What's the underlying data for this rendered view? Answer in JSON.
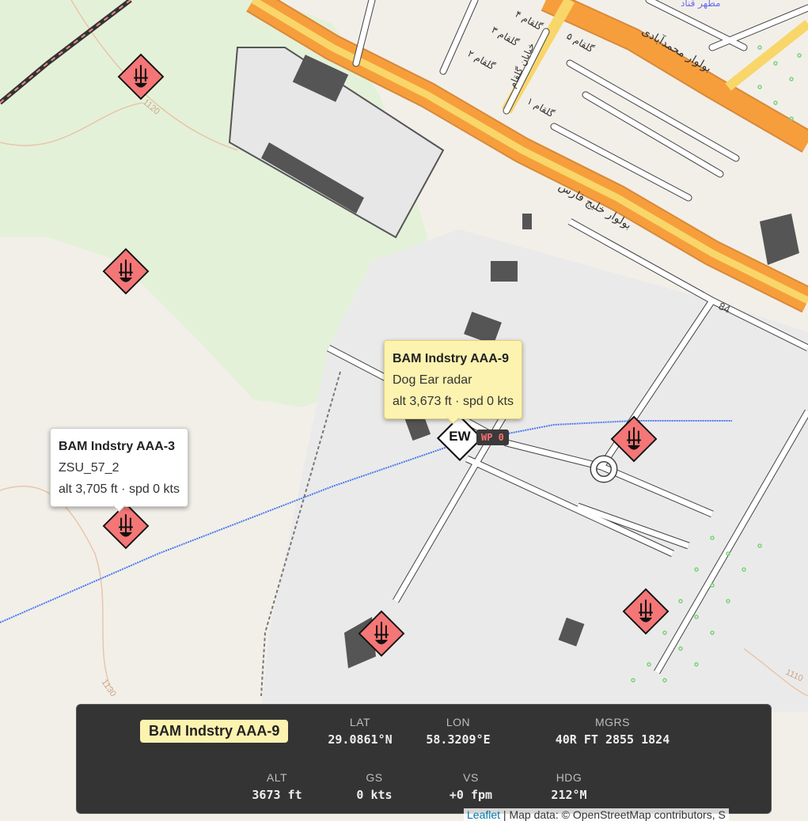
{
  "popups": [
    {
      "title": "BAM Indstry AAA-3",
      "type": "ZSU_57_2",
      "stats": "alt 3,705 ft · spd 0 kts"
    },
    {
      "title": "BAM Indstry AAA-9",
      "type": "Dog Ear radar",
      "stats": "alt 3,673 ft · spd 0 kts"
    }
  ],
  "ew_marker": {
    "label": "EW",
    "waypoint": "WP 0"
  },
  "road_labels": {
    "ring": "84",
    "contour1": "1130",
    "contour2": "1110",
    "contour3": "1120",
    "blvd1": "بولوار خلیج فارس",
    "blvd2": "بولوار محمدآبادی",
    "st1": "خیابان گلقام",
    "lane1": "گلقام ۱",
    "lane2": "گلقام ۲",
    "lane3": "گلقام ۳",
    "lane4": "گلقام ۴",
    "lane5": "گلقام ۵",
    "place": "مطهر قناد"
  },
  "panel": {
    "name": "BAM Indstry AAA-9",
    "lat_label": "LAT",
    "lat": "29.0861°N",
    "lon_label": "LON",
    "lon": "58.3209°E",
    "mgrs_label": "MGRS",
    "mgrs": "40R FT 2855 1824",
    "alt_label": "ALT",
    "alt": "3673 ft",
    "gs_label": "GS",
    "gs": "0 kts",
    "vs_label": "VS",
    "vs": "+0 fpm",
    "hdg_label": "HDG",
    "hdg": "212°M"
  },
  "attribution": {
    "leaflet": "Leaflet",
    "sep": " | Map data: © OpenStreetMap contributors, S"
  },
  "colors": {
    "threat": "#f57676",
    "major_road": "#f79e3c",
    "primary_road": "#f8d66a",
    "park": "#e6f2dc",
    "track": "#4a7bf0"
  },
  "icons": {
    "threat": "sam-radar-icon",
    "ew": "ew-diamond-icon"
  }
}
